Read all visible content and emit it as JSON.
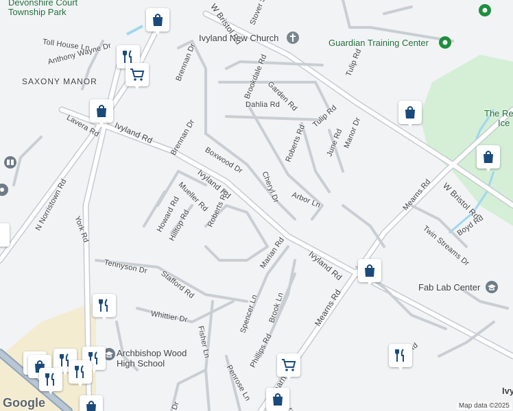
{
  "map": {
    "colors": {
      "background": "#f1f3f4",
      "road": "#ffffff",
      "road_edge": "#c6cbd1",
      "park": "#d4efd6",
      "field": "#f3ecd0",
      "water": "#9fd6f2",
      "pin": "#1a4a7a",
      "poi_green": "#1e8e3e",
      "poi_grey": "#6f7b87",
      "place_text": "#1e6b3a"
    },
    "street_labels": [
      {
        "name": "Toll House Ln"
      },
      {
        "name": "Anthony Wayne Dr"
      },
      {
        "name": "Lavera Rd"
      },
      {
        "name": "Ivyland Rd"
      },
      {
        "name": "N Norristown Rd"
      },
      {
        "name": "York Rd"
      },
      {
        "name": "Brennan Dr"
      },
      {
        "name": "Brennan Dr"
      },
      {
        "name": "W Bristol Rd"
      },
      {
        "name": "Stover St"
      },
      {
        "name": "Brookdale Rd"
      },
      {
        "name": "Garden Rd"
      },
      {
        "name": "Dahlia Rd"
      },
      {
        "name": "Tulip Rd"
      },
      {
        "name": "Tulip Rd"
      },
      {
        "name": "Boxwood Dr"
      },
      {
        "name": "Roberts Rd"
      },
      {
        "name": "June Rd"
      },
      {
        "name": "Manor Dr"
      },
      {
        "name": "Cheryl Dr"
      },
      {
        "name": "Arbor Ln"
      },
      {
        "name": "Ivyland Rd"
      },
      {
        "name": "Mueller Rd"
      },
      {
        "name": "Howard Rd"
      },
      {
        "name": "Hilltop Rd"
      },
      {
        "name": "Roberts Rd"
      },
      {
        "name": "Mearns Rd"
      },
      {
        "name": "W Bristol Rd"
      },
      {
        "name": "Twin Streams Dr"
      },
      {
        "name": "Boyd Rd"
      },
      {
        "name": "Marian Rd"
      },
      {
        "name": "Ivyland Rd"
      },
      {
        "name": "Tennyson Dr"
      },
      {
        "name": "Stafford Rd"
      },
      {
        "name": "Mearns Rd"
      },
      {
        "name": "Spencer Ln"
      },
      {
        "name": "Brook Ln"
      },
      {
        "name": "Whittier Dr"
      },
      {
        "name": "Fisher Ln"
      },
      {
        "name": "Phillips Rd"
      },
      {
        "name": "Penrose Ln"
      },
      {
        "name": "Rd"
      },
      {
        "name": "Mearns Rd"
      },
      {
        "name": "Dr"
      },
      {
        "name": "ray"
      }
    ],
    "places": [
      {
        "name": "Devonshire Court",
        "icon": ""
      },
      {
        "name": "Township Park",
        "icon": ""
      },
      {
        "name": "SAXONY MANOR",
        "icon": ""
      },
      {
        "name": "Ivyland New Church",
        "icon": "church-icon"
      },
      {
        "name": "Guardian Training Center",
        "icon": "place-icon"
      },
      {
        "name": "The Re",
        "icon": ""
      },
      {
        "name": "Ice",
        "icon": ""
      },
      {
        "name": "Fab Lab Center",
        "icon": "school-icon"
      },
      {
        "name": "Archbishop Wood",
        "icon": "school-icon"
      },
      {
        "name": "High School",
        "icon": ""
      },
      {
        "name": "Ivy",
        "icon": ""
      }
    ],
    "markers": [
      {
        "type": "restaurant-icon"
      },
      {
        "type": "shopping-bag-icon"
      },
      {
        "type": "shopping-cart-icon"
      },
      {
        "type": "shopping-bag-icon"
      },
      {
        "type": "shopping-bag-icon"
      },
      {
        "type": "shopping-bag-icon"
      },
      {
        "type": "shopping-bag-icon"
      },
      {
        "type": "restaurant-icon"
      },
      {
        "type": "restaurant-icon"
      },
      {
        "type": "shopping-cart-icon"
      },
      {
        "type": "shopping-bag-icon"
      },
      {
        "type": "restaurant-icon"
      },
      {
        "type": "shopping-bag-icon"
      },
      {
        "type": "restaurant-icon"
      },
      {
        "type": "restaurant-icon"
      },
      {
        "type": "restaurant-icon"
      },
      {
        "type": "restaurant-icon"
      },
      {
        "type": "restaurant-icon"
      },
      {
        "type": "shopping-bag-icon"
      }
    ],
    "attribution": "Map data ©2025",
    "logo": "Google"
  }
}
